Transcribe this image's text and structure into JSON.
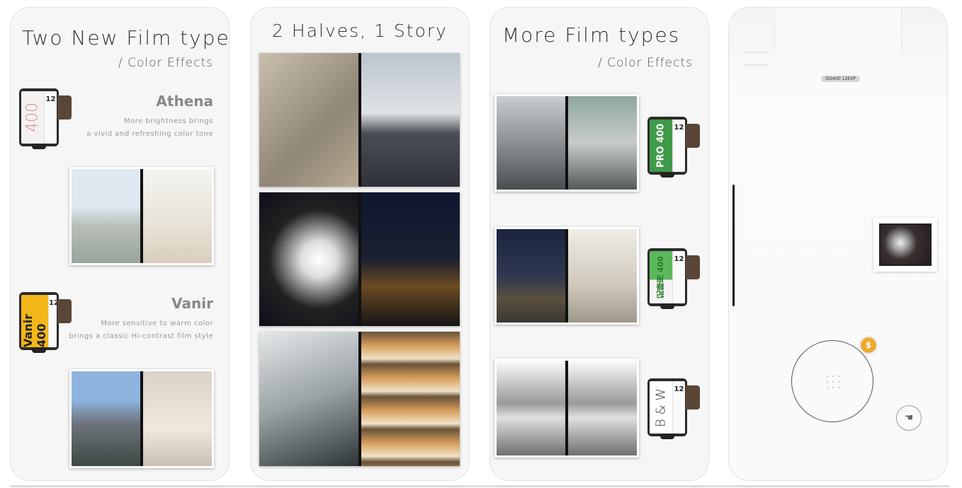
{
  "panel1": {
    "title": "Two New Film types",
    "subtitle": "/ Color Effects",
    "films": [
      {
        "name": "Athena",
        "desc_line1": "More brightness brings",
        "desc_line2": "a vivid and refreshing color tone",
        "can_text": "400",
        "exp": "12"
      },
      {
        "name": "Vanir",
        "desc_line1": "More sensitive to warm color",
        "desc_line2": "brings a classic Hi-contrast film style",
        "can_text": "Vanir 400",
        "exp": "12"
      }
    ]
  },
  "panel2": {
    "title": "2 Halves, 1 Story"
  },
  "panel3": {
    "title": "More Film types",
    "subtitle": "/ Color Effects",
    "films": [
      {
        "can_text": "PRO 400",
        "exp": "12",
        "color": "#3f9a4a"
      },
      {
        "can_text": "記錄用 400",
        "exp": "12",
        "color": "#5cb85c"
      },
      {
        "can_text": "B & W",
        "exp": "12",
        "color": "#ffffff"
      }
    ]
  },
  "panel4": {
    "badge": "ISO400 12EXP"
  },
  "colors": {
    "accent_orange": "#f0a830",
    "athena_red": "#e08a8a",
    "vanir_yellow": "#f3b619"
  }
}
